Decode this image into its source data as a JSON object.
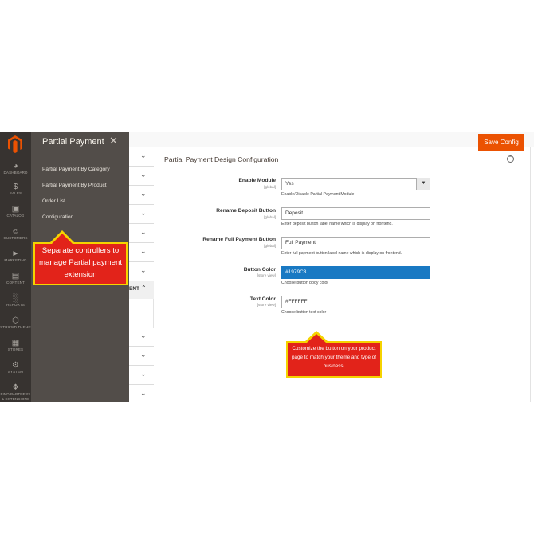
{
  "admin_nav": {
    "items": [
      {
        "label": "DASHBOARD",
        "icon": "dashboard-icon"
      },
      {
        "label": "SALES",
        "icon": "dollar-icon"
      },
      {
        "label": "CATALOG",
        "icon": "catalog-icon"
      },
      {
        "label": "CUSTOMERS",
        "icon": "customers-icon"
      },
      {
        "label": "MARKETING",
        "icon": "megaphone-icon"
      },
      {
        "label": "CONTENT",
        "icon": "content-icon"
      },
      {
        "label": "REPORTS",
        "icon": "bar-chart-icon"
      },
      {
        "label": "STRIKND THEME",
        "icon": "hexagon-icon"
      },
      {
        "label": "STORES",
        "icon": "store-icon"
      },
      {
        "label": "SYSTEM",
        "icon": "gear-icon"
      },
      {
        "label": "FIND PARTNERS & EXTENSIONS",
        "icon": "partners-icon"
      }
    ]
  },
  "flyout": {
    "title": "Partial Payment",
    "links": [
      "Partial Payment By Category",
      "Partial Payment By Product",
      "Order List",
      "Configuration"
    ]
  },
  "callouts": {
    "left": "Separate controllers to manage Partial payment extension",
    "right": "Customize the button on your product page to match your theme and type of business."
  },
  "tab_column": {
    "section_label": "ENT"
  },
  "header": {
    "save_label": "Save Config"
  },
  "config": {
    "section_title": "Partial Payment Design Configuration",
    "fields": [
      {
        "label": "Enable Module",
        "scope": "[global]",
        "value": "Yes",
        "note": "Enable/Disable Partial Payment Module"
      },
      {
        "label": "Rename Deposit Button",
        "scope": "[global]",
        "value": "Deposit",
        "note": "Enter deposit button label name which is display on frontend."
      },
      {
        "label": "Rename Full Payment Button",
        "scope": "[global]",
        "value": "Full Payment",
        "note": "Enter full payment button label name which is display on frontend."
      },
      {
        "label": "Button Color",
        "scope": "[store view]",
        "value": "#1979C3",
        "note": "Choose button body color"
      },
      {
        "label": "Text Color",
        "scope": "[store view]",
        "value": "#FFFFFF",
        "note": "Choose button text color"
      }
    ]
  },
  "colors": {
    "brand_orange": "#eb5202",
    "nav_dark": "#373330",
    "flyout": "#524d49",
    "button_color": "#1979c3",
    "callout_red": "#e2231a",
    "callout_border": "#f5d300"
  }
}
